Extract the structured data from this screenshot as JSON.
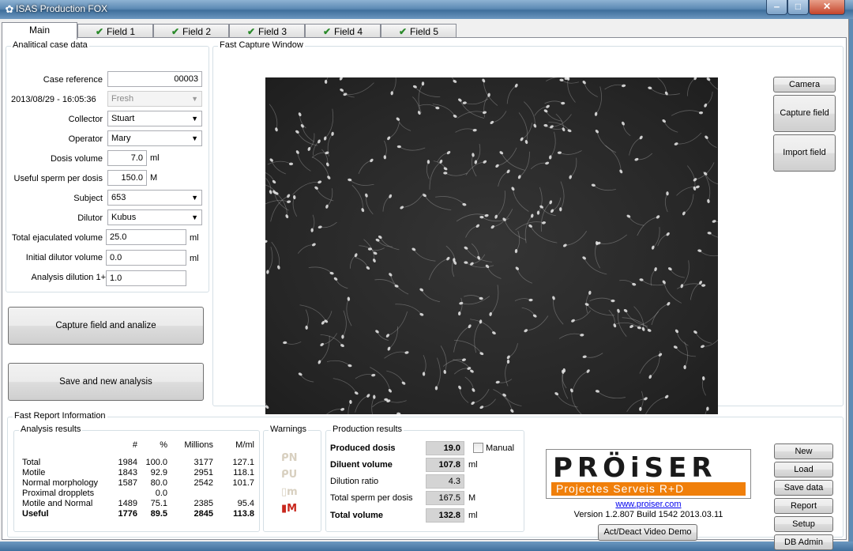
{
  "window": {
    "title": "ISAS Production FOX"
  },
  "tabs": [
    {
      "label": "Main",
      "active": true,
      "checked": false
    },
    {
      "label": "Field 1",
      "checked": true
    },
    {
      "label": "Field 2",
      "checked": true
    },
    {
      "label": "Field 3",
      "checked": true
    },
    {
      "label": "Field 4",
      "checked": true
    },
    {
      "label": "Field 5",
      "checked": true
    }
  ],
  "case": {
    "group_title": "Analitical case data",
    "case_reference_label": "Case reference",
    "case_reference": "00003",
    "datetime": "2013/08/29 - 16:05:36",
    "fresh": "Fresh",
    "collector_label": "Collector",
    "collector": "Stuart",
    "operator_label": "Operator",
    "operator": "Mary",
    "dosis_volume_label": "Dosis volume",
    "dosis_volume": "7.0",
    "dosis_volume_unit": "ml",
    "useful_sperm_label": "Useful sperm per dosis",
    "useful_sperm": "150.0",
    "useful_sperm_unit": "M",
    "subject_label": "Subject",
    "subject": "653",
    "dilutor_label": "Dilutor",
    "dilutor": "Kubus",
    "total_ejac_label": "Total ejaculated volume",
    "total_ejac": "25.0",
    "total_ejac_unit": "ml",
    "initial_dilutor_label": "Initial dilutor volume",
    "initial_dilutor": "0.0",
    "initial_dilutor_unit": "ml",
    "analysis_dilution_label": "Analysis dilution  1+",
    "analysis_dilution": "1.0"
  },
  "actions": {
    "capture_analize": "Capture field and analize",
    "save_new": "Save and new analysis"
  },
  "capture": {
    "group_title": "Fast Capture Window",
    "camera": "Camera",
    "capture_field": "Capture field",
    "import_field": "Import field"
  },
  "report": {
    "group_title": "Fast Report Information",
    "analysis": {
      "title": "Analysis results",
      "headers": [
        "#",
        "%",
        "Millions",
        "M/ml"
      ],
      "rows": [
        {
          "label": "Total",
          "n": "1984",
          "pct": "100.0",
          "millions": "3177",
          "mml": "127.1"
        },
        {
          "label": "Motile",
          "n": "1843",
          "pct": "92.9",
          "millions": "2951",
          "mml": "118.1"
        },
        {
          "label": "Normal morphology",
          "n": "1587",
          "pct": "80.0",
          "millions": "2542",
          "mml": "101.7"
        },
        {
          "label": "Proximal dropplets",
          "n": "",
          "pct": "0.0",
          "millions": "",
          "mml": ""
        },
        {
          "label": "Motile and Normal",
          "n": "1489",
          "pct": "75.1",
          "millions": "2385",
          "mml": "95.4"
        },
        {
          "label": "Useful",
          "n": "1776",
          "pct": "89.5",
          "millions": "2845",
          "mml": "113.8",
          "bold": true
        }
      ]
    },
    "warnings": {
      "title": "Warnings",
      "icons": [
        "N",
        "U",
        "m",
        "M"
      ]
    },
    "production": {
      "title": "Production results",
      "produced_dosis_label": "Produced dosis",
      "produced_dosis": "19.0",
      "manual_label": "Manual",
      "diluent_volume_label": "Diluent volume",
      "diluent_volume": "107.8",
      "diluent_volume_unit": "ml",
      "dilution_ratio_label": "Dilution ratio",
      "dilution_ratio": "4.3",
      "total_sperm_label": "Total sperm per dosis",
      "total_sperm": "167.5",
      "total_sperm_unit": "M",
      "total_volume_label": "Total volume",
      "total_volume": "132.8",
      "total_volume_unit": "ml"
    }
  },
  "branding": {
    "logo_word": "PRÖiSER",
    "logo_band": "Projectes  Serveis R+D",
    "url": "www.proiser.com",
    "version": "Version 1.2.807 Build 1542 2013.03.11",
    "video_demo": "Act/Deact Video Demo"
  },
  "side_buttons": {
    "new": "New",
    "load": "Load",
    "save_data": "Save data",
    "report": "Report",
    "setup": "Setup",
    "db_admin": "DB Admin"
  },
  "colors": {
    "accent_orange": "#f07f0a",
    "warning_red": "#c8281e",
    "titlebar_blue": "#5e8bb5"
  }
}
